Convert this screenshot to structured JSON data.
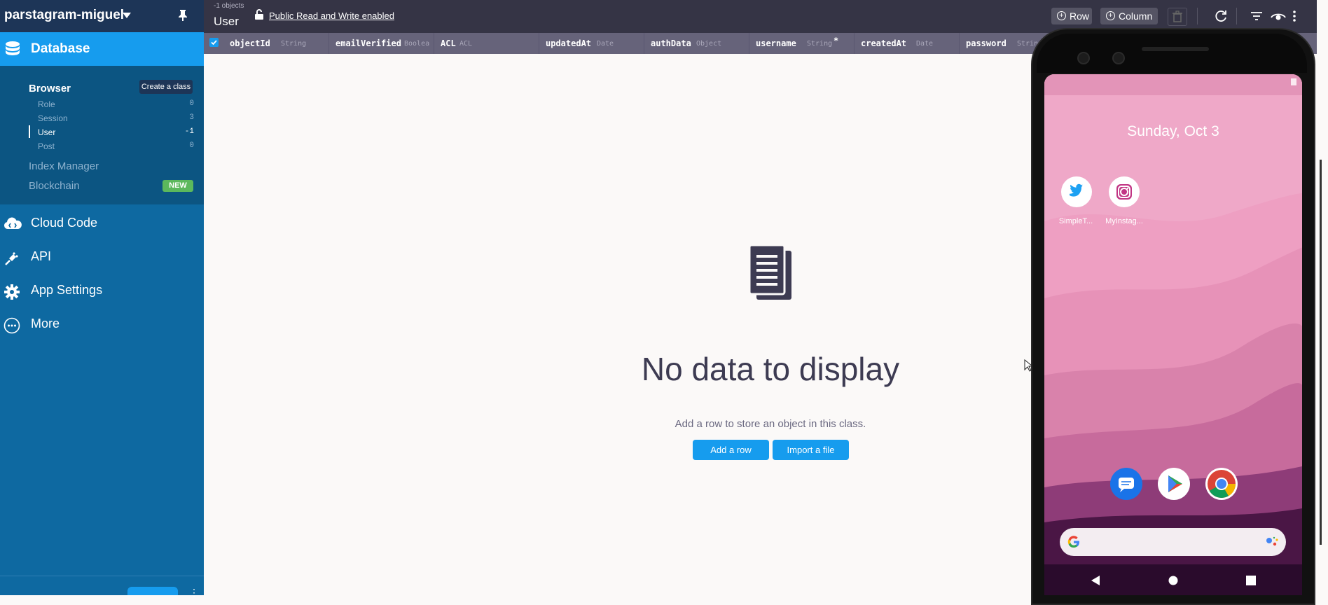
{
  "app": {
    "name": "parstagram-miguel"
  },
  "nav": {
    "database": "Database",
    "browser": "Browser",
    "create_class": "Create a class",
    "classes": [
      {
        "name": "Role",
        "count": "0"
      },
      {
        "name": "Session",
        "count": "3"
      },
      {
        "name": "User",
        "count": "-1",
        "active": true
      },
      {
        "name": "Post",
        "count": "0"
      }
    ],
    "index_manager": "Index Manager",
    "blockchain": "Blockchain",
    "new_badge": "NEW",
    "cloud_code": "Cloud Code",
    "api": "API",
    "app_settings": "App Settings",
    "more": "More"
  },
  "toolbar": {
    "object_count": "-1 objects",
    "class_name": "User",
    "permission_text": "Public Read and Write enabled",
    "row_label": "Row",
    "column_label": "Column"
  },
  "columns": [
    {
      "name": "objectId",
      "type": "String"
    },
    {
      "name": "emailVerified",
      "type": "Boolea"
    },
    {
      "name": "ACL",
      "type": "ACL"
    },
    {
      "name": "updatedAt",
      "type": "Date"
    },
    {
      "name": "authData",
      "type": "Object"
    },
    {
      "name": "username",
      "type": "String",
      "required_mark": "*"
    },
    {
      "name": "createdAt",
      "type": "Date"
    },
    {
      "name": "password",
      "type": "String"
    }
  ],
  "empty_state": {
    "title": "No data to display",
    "subtitle": "Add a row to store an object in this class.",
    "add_row": "Add a row",
    "import_file": "Import a file"
  },
  "phone": {
    "date": "Sunday, Oct 3",
    "apps": [
      {
        "label": "SimpleT...",
        "icon": "twitter-icon"
      },
      {
        "label": "MyInstag...",
        "icon": "instagram-icon"
      }
    ],
    "dock": [
      "messages-icon",
      "play-store-icon",
      "chrome-icon"
    ]
  },
  "colors": {
    "sidebar": "#0e69a1",
    "accent": "#169cee",
    "toolbar": "#353445",
    "header": "#66637a"
  }
}
